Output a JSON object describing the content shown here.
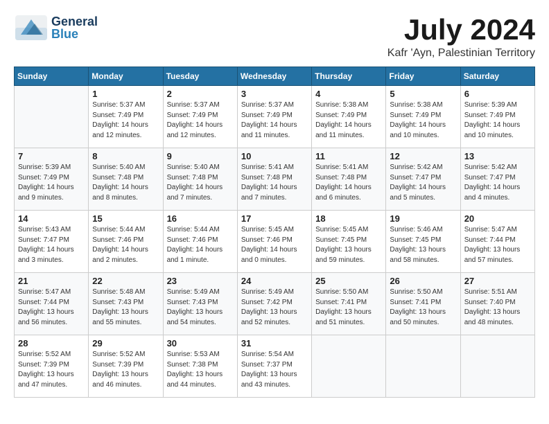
{
  "header": {
    "logo_general": "General",
    "logo_blue": "Blue",
    "month_title": "July 2024",
    "location": "Kafr 'Ayn, Palestinian Territory"
  },
  "weekdays": [
    "Sunday",
    "Monday",
    "Tuesday",
    "Wednesday",
    "Thursday",
    "Friday",
    "Saturday"
  ],
  "weeks": [
    [
      {
        "day": "",
        "info": ""
      },
      {
        "day": "1",
        "info": "Sunrise: 5:37 AM\nSunset: 7:49 PM\nDaylight: 14 hours\nand 12 minutes."
      },
      {
        "day": "2",
        "info": "Sunrise: 5:37 AM\nSunset: 7:49 PM\nDaylight: 14 hours\nand 12 minutes."
      },
      {
        "day": "3",
        "info": "Sunrise: 5:37 AM\nSunset: 7:49 PM\nDaylight: 14 hours\nand 11 minutes."
      },
      {
        "day": "4",
        "info": "Sunrise: 5:38 AM\nSunset: 7:49 PM\nDaylight: 14 hours\nand 11 minutes."
      },
      {
        "day": "5",
        "info": "Sunrise: 5:38 AM\nSunset: 7:49 PM\nDaylight: 14 hours\nand 10 minutes."
      },
      {
        "day": "6",
        "info": "Sunrise: 5:39 AM\nSunset: 7:49 PM\nDaylight: 14 hours\nand 10 minutes."
      }
    ],
    [
      {
        "day": "7",
        "info": "Sunrise: 5:39 AM\nSunset: 7:49 PM\nDaylight: 14 hours\nand 9 minutes."
      },
      {
        "day": "8",
        "info": "Sunrise: 5:40 AM\nSunset: 7:48 PM\nDaylight: 14 hours\nand 8 minutes."
      },
      {
        "day": "9",
        "info": "Sunrise: 5:40 AM\nSunset: 7:48 PM\nDaylight: 14 hours\nand 7 minutes."
      },
      {
        "day": "10",
        "info": "Sunrise: 5:41 AM\nSunset: 7:48 PM\nDaylight: 14 hours\nand 7 minutes."
      },
      {
        "day": "11",
        "info": "Sunrise: 5:41 AM\nSunset: 7:48 PM\nDaylight: 14 hours\nand 6 minutes."
      },
      {
        "day": "12",
        "info": "Sunrise: 5:42 AM\nSunset: 7:47 PM\nDaylight: 14 hours\nand 5 minutes."
      },
      {
        "day": "13",
        "info": "Sunrise: 5:42 AM\nSunset: 7:47 PM\nDaylight: 14 hours\nand 4 minutes."
      }
    ],
    [
      {
        "day": "14",
        "info": "Sunrise: 5:43 AM\nSunset: 7:47 PM\nDaylight: 14 hours\nand 3 minutes."
      },
      {
        "day": "15",
        "info": "Sunrise: 5:44 AM\nSunset: 7:46 PM\nDaylight: 14 hours\nand 2 minutes."
      },
      {
        "day": "16",
        "info": "Sunrise: 5:44 AM\nSunset: 7:46 PM\nDaylight: 14 hours\nand 1 minute."
      },
      {
        "day": "17",
        "info": "Sunrise: 5:45 AM\nSunset: 7:46 PM\nDaylight: 14 hours\nand 0 minutes."
      },
      {
        "day": "18",
        "info": "Sunrise: 5:45 AM\nSunset: 7:45 PM\nDaylight: 13 hours\nand 59 minutes."
      },
      {
        "day": "19",
        "info": "Sunrise: 5:46 AM\nSunset: 7:45 PM\nDaylight: 13 hours\nand 58 minutes."
      },
      {
        "day": "20",
        "info": "Sunrise: 5:47 AM\nSunset: 7:44 PM\nDaylight: 13 hours\nand 57 minutes."
      }
    ],
    [
      {
        "day": "21",
        "info": "Sunrise: 5:47 AM\nSunset: 7:44 PM\nDaylight: 13 hours\nand 56 minutes."
      },
      {
        "day": "22",
        "info": "Sunrise: 5:48 AM\nSunset: 7:43 PM\nDaylight: 13 hours\nand 55 minutes."
      },
      {
        "day": "23",
        "info": "Sunrise: 5:49 AM\nSunset: 7:43 PM\nDaylight: 13 hours\nand 54 minutes."
      },
      {
        "day": "24",
        "info": "Sunrise: 5:49 AM\nSunset: 7:42 PM\nDaylight: 13 hours\nand 52 minutes."
      },
      {
        "day": "25",
        "info": "Sunrise: 5:50 AM\nSunset: 7:41 PM\nDaylight: 13 hours\nand 51 minutes."
      },
      {
        "day": "26",
        "info": "Sunrise: 5:50 AM\nSunset: 7:41 PM\nDaylight: 13 hours\nand 50 minutes."
      },
      {
        "day": "27",
        "info": "Sunrise: 5:51 AM\nSunset: 7:40 PM\nDaylight: 13 hours\nand 48 minutes."
      }
    ],
    [
      {
        "day": "28",
        "info": "Sunrise: 5:52 AM\nSunset: 7:39 PM\nDaylight: 13 hours\nand 47 minutes."
      },
      {
        "day": "29",
        "info": "Sunrise: 5:52 AM\nSunset: 7:39 PM\nDaylight: 13 hours\nand 46 minutes."
      },
      {
        "day": "30",
        "info": "Sunrise: 5:53 AM\nSunset: 7:38 PM\nDaylight: 13 hours\nand 44 minutes."
      },
      {
        "day": "31",
        "info": "Sunrise: 5:54 AM\nSunset: 7:37 PM\nDaylight: 13 hours\nand 43 minutes."
      },
      {
        "day": "",
        "info": ""
      },
      {
        "day": "",
        "info": ""
      },
      {
        "day": "",
        "info": ""
      }
    ]
  ]
}
